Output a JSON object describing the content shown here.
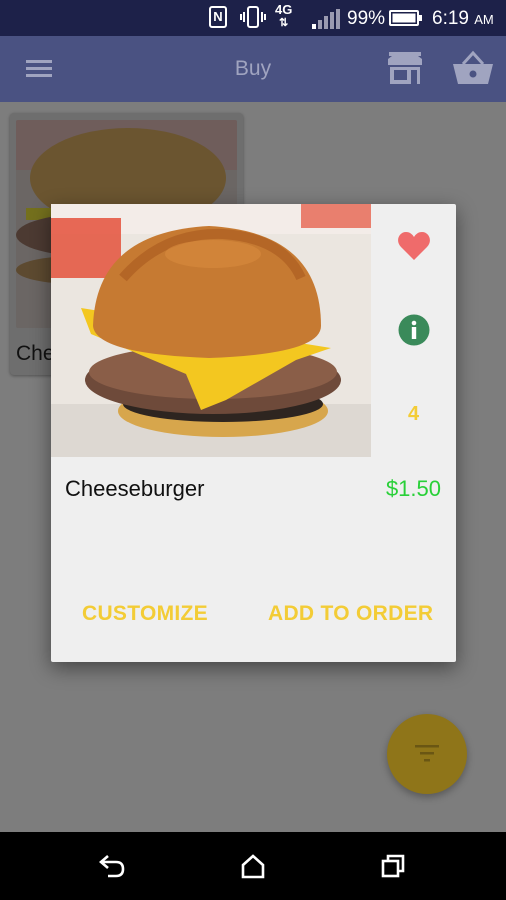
{
  "status_bar": {
    "nfc_label": "N",
    "network_type": "4G",
    "battery_percent": "99%",
    "time": "6:19",
    "ampm": "AM"
  },
  "app_bar": {
    "title": "Buy",
    "icons": [
      "menu-icon",
      "store-icon",
      "basket-icon"
    ]
  },
  "background_card": {
    "name": "Che"
  },
  "dialog": {
    "item_name": "Cheeseburger",
    "price": "$1.50",
    "count": "4",
    "customize_label": "CUSTOMIZE",
    "add_to_order_label": "ADD TO ORDER",
    "icons": [
      "heart-icon",
      "info-icon"
    ]
  },
  "fab": {
    "icon": "filter-icon"
  },
  "nav_bar": {
    "icons": [
      "back-icon",
      "home-icon",
      "recents-icon"
    ]
  },
  "colors": {
    "status_bar": "#1d2149",
    "app_bar": "#4a5282",
    "accent_yellow": "#f3cc36",
    "price_green": "#29d038",
    "heart_red": "#ef6b6b",
    "info_green": "#3a8a5a"
  }
}
